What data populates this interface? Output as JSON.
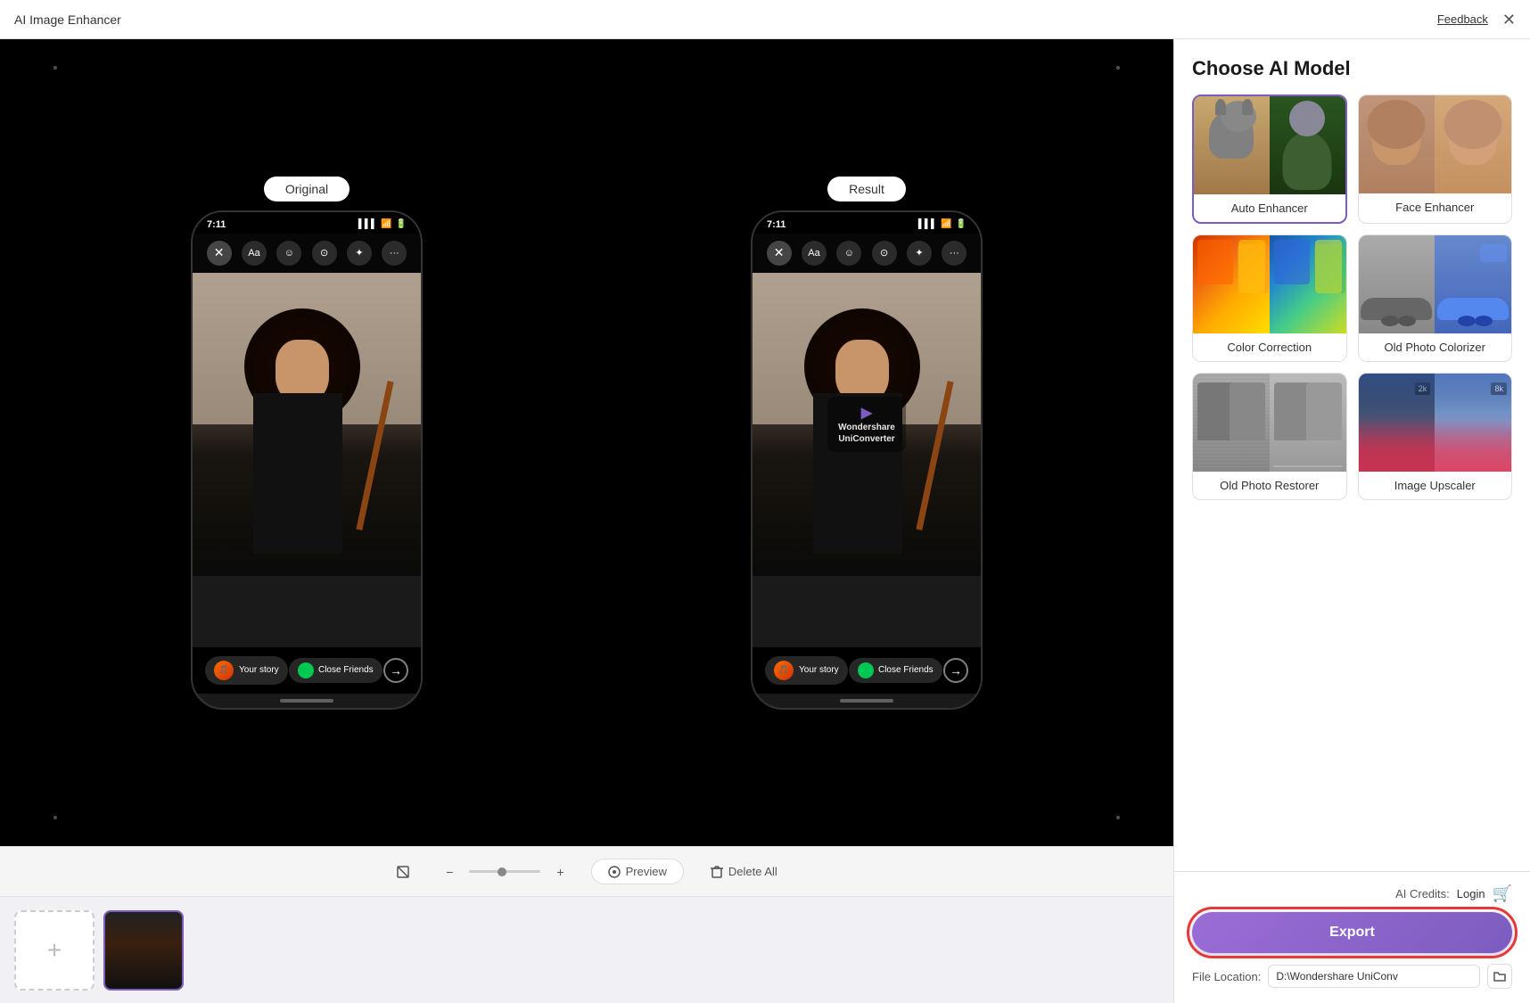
{
  "titleBar": {
    "appTitle": "AI Image Enhancer",
    "feedbackLabel": "Feedback",
    "closeLabel": "✕"
  },
  "imageViewer": {
    "originalLabel": "Original",
    "resultLabel": "Result",
    "statusTime": "7:11",
    "storyText": "Your story",
    "closeFriendsText": "Close Friends",
    "watermarkText": "Wondershare\nUniConverter"
  },
  "toolbar": {
    "zoomOutIcon": "−",
    "zoomInIcon": "+",
    "previewLabel": "Preview",
    "deleteAllLabel": "Delete All"
  },
  "thumbnails": {
    "addLabel": "+"
  },
  "aiModel": {
    "sectionTitle": "Choose AI Model",
    "models": [
      {
        "id": "auto-enhancer",
        "label": "Auto Enhancer",
        "selected": true
      },
      {
        "id": "face-enhancer",
        "label": "Face Enhancer",
        "selected": false
      },
      {
        "id": "color-correction",
        "label": "Color Correction",
        "selected": false
      },
      {
        "id": "old-photo-colorizer",
        "label": "Old Photo Colorizer",
        "selected": false
      },
      {
        "id": "old-photo-restorer",
        "label": "Old Photo Restorer",
        "selected": false
      },
      {
        "id": "image-upscaler",
        "label": "Image Upscaler",
        "selected": false
      }
    ],
    "upscalerBadgeLeft": "2k",
    "upscalerBadgeRight": "8k"
  },
  "bottomPanel": {
    "aiCreditsLabel": "AI Credits:",
    "loginLabel": "Login",
    "exportLabel": "Export",
    "fileLocationLabel": "File Location:",
    "fileLocationPath": "D:\\Wondershare UniConv"
  }
}
